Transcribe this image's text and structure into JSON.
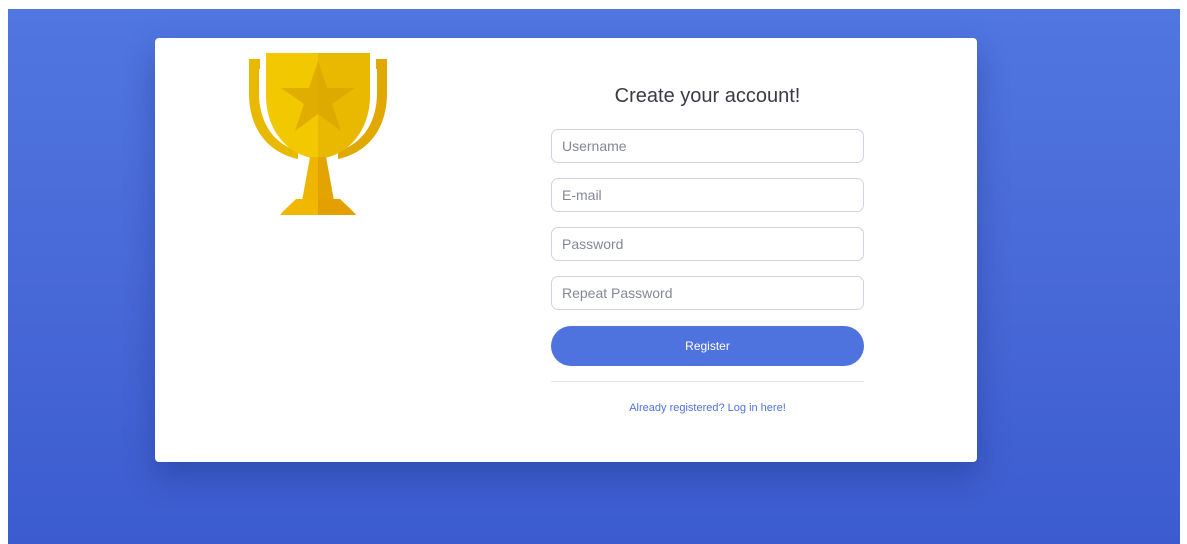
{
  "form": {
    "title": "Create your account!",
    "username_placeholder": "Username",
    "email_placeholder": "E-mail",
    "password_placeholder": "Password",
    "repeat_password_placeholder": "Repeat Password",
    "register_label": "Register",
    "login_link_label": "Already registered? Log in here!"
  },
  "colors": {
    "background": "#4e73df",
    "accent": "#4e73df",
    "trophy_gold": "#f2c200"
  },
  "icons": {
    "illustration": "trophy-icon"
  }
}
